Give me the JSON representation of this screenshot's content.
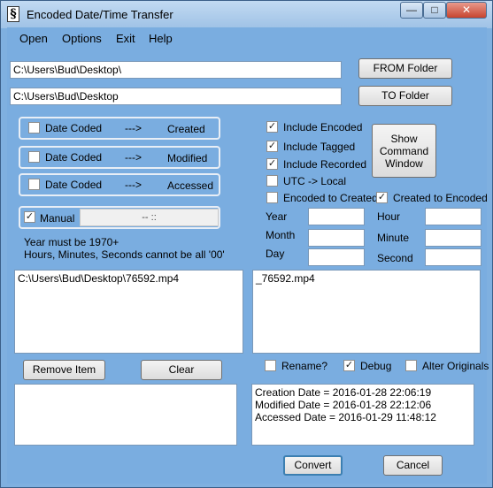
{
  "window": {
    "title": "Encoded Date/Time Transfer",
    "icon_glyph": "§"
  },
  "menu": [
    "Open",
    "Options",
    "Exit",
    "Help"
  ],
  "paths": {
    "from_value": "C:\\Users\\Bud\\Desktop\\",
    "from_button": "FROM Folder",
    "to_value": "C:\\Users\\Bud\\Desktop",
    "to_button": "TO Folder"
  },
  "mappings": [
    {
      "check": "Date Coded",
      "arrow": "--->",
      "target": "Created"
    },
    {
      "check": "Date Coded",
      "arrow": "--->",
      "target": "Modified"
    },
    {
      "check": "Date Coded",
      "arrow": "--->",
      "target": "Accessed"
    }
  ],
  "manual": {
    "label": "Manual",
    "value": "-- ::"
  },
  "notes": [
    "Year must be 1970+",
    "Hours, Minutes, Seconds cannot be all '00'"
  ],
  "options": {
    "include_encoded": "Include Encoded",
    "include_tagged": "Include Tagged",
    "include_recorded": "Include Recorded",
    "utc_local": "UTC -> Local",
    "encoded_to_created": "Encoded to Created",
    "created_to_encoded": "Created to Encoded",
    "show_cmd": "Show Command Window"
  },
  "fields": {
    "year": "Year",
    "month": "Month",
    "day": "Day",
    "hour": "Hour",
    "minute": "Minute",
    "second": "Second"
  },
  "lists": {
    "left_item": "C:\\Users\\Bud\\Desktop\\76592.mp4",
    "right_item": "_76592.mp4"
  },
  "buttons": {
    "remove": "Remove Item",
    "clear": "Clear",
    "convert": "Convert",
    "cancel": "Cancel"
  },
  "flags": {
    "rename": "Rename?",
    "debug": "Debug",
    "alter": "Alter Originals"
  },
  "info": [
    "Creation Date = 2016-01-28 22:06:19",
    "Modified Date = 2016-01-28 22:12:06",
    "Accessed Date = 2016-01-29 11:48:12"
  ],
  "checked": {
    "mark": "✓"
  }
}
